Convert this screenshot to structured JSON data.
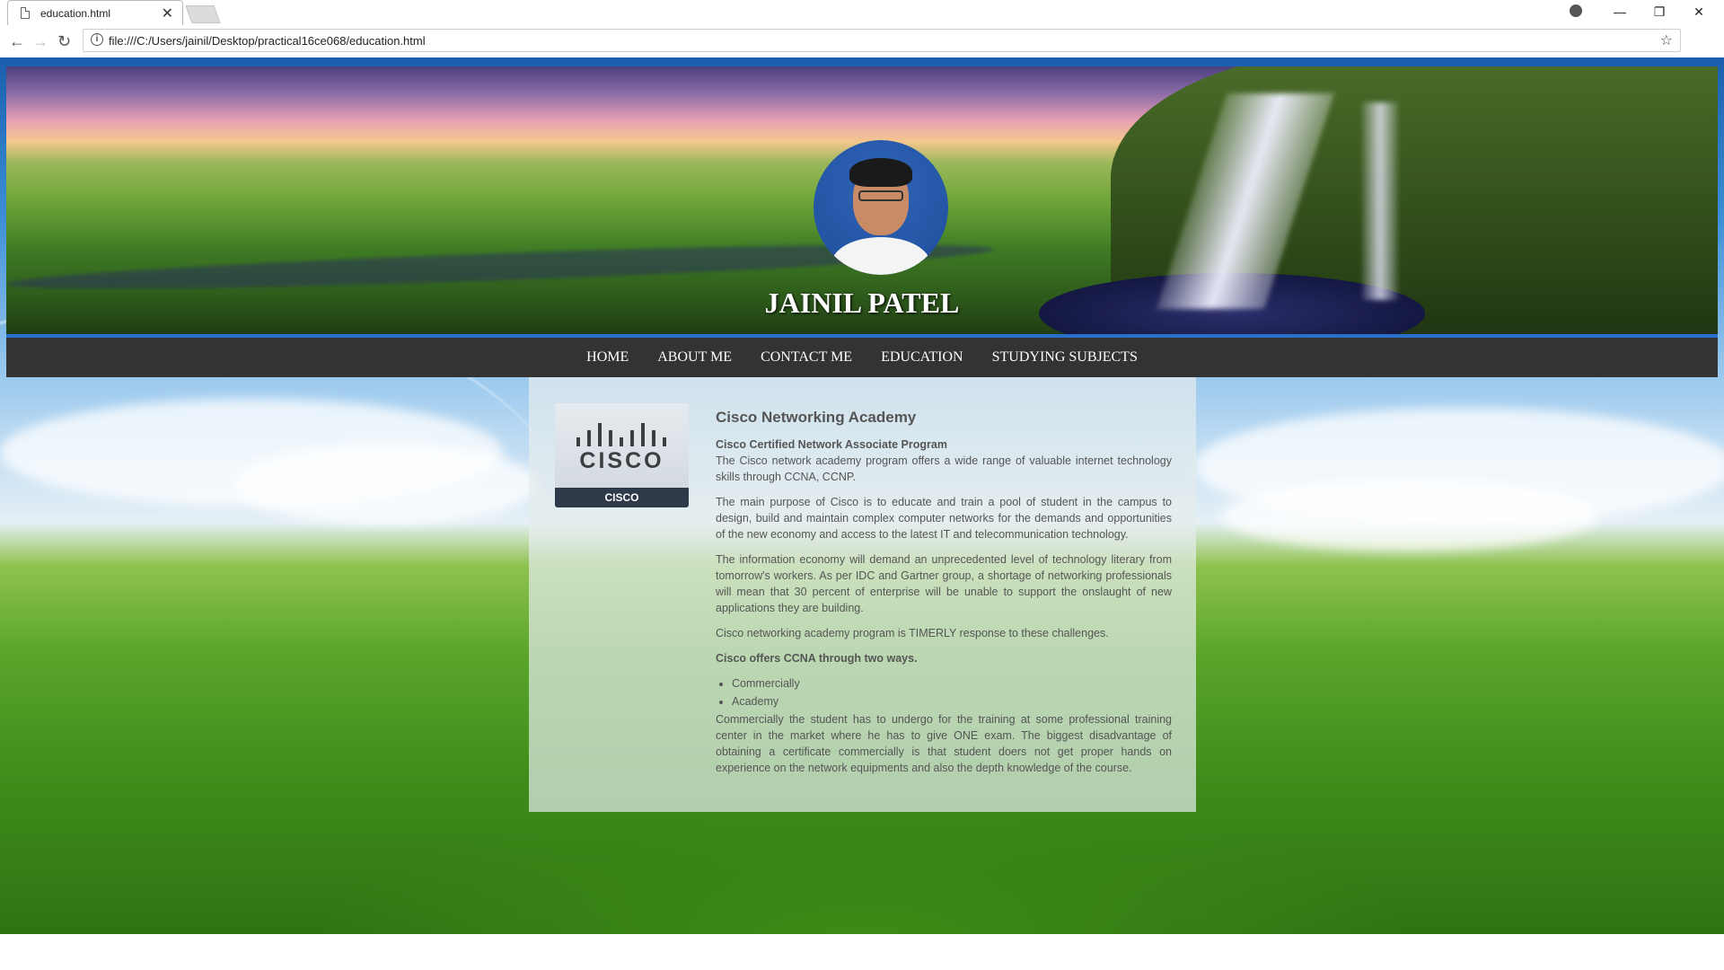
{
  "browser": {
    "tab_title": "education.html",
    "tab_close": "✕",
    "url": "file:///C:/Users/jainil/Desktop/practical16ce068/education.html",
    "back": "←",
    "forward": "→",
    "reload": "↻",
    "star": "☆",
    "menu": "⋮",
    "minimize": "—",
    "restore": "❐",
    "close": "✕"
  },
  "header": {
    "name": "JAINIL PATEL"
  },
  "nav": {
    "items": [
      "HOME",
      "ABOUT ME",
      "CONTACT ME",
      "EDUCATION",
      "STUDYING SUBJECTS"
    ]
  },
  "logo": {
    "word": "CISCO",
    "caption": "CISCO"
  },
  "article": {
    "title": "Cisco Networking Academy",
    "subtitle": "Cisco Certified Network Associate Program",
    "p1": "The Cisco network academy program offers a wide range of valuable internet technology skills through CCNA, CCNP.",
    "p2": "The main purpose of Cisco is to educate and train a pool of student in the campus to design, build and maintain complex computer networks for the demands and opportunities of the new economy and access to the latest IT and telecommunication technology.",
    "p3": "The information economy will demand an unprecedented level of technology literary from tomorrow's workers. As per IDC and Gartner group, a shortage of networking professionals will mean that 30 percent of enterprise will be unable to support the onslaught of new applications they are building.",
    "p4": "Cisco networking academy program is TIMERLY response to these challenges.",
    "p5": "Cisco offers CCNA through two ways.",
    "list": [
      "Commercially",
      "Academy"
    ],
    "p6": "Commercially the student has to undergo for the training at some professional training center in the market where he has to give ONE exam. The biggest disadvantage of obtaining a certificate commercially is that student doers not get proper hands on experience on the network equipments and also the depth knowledge of the course."
  }
}
